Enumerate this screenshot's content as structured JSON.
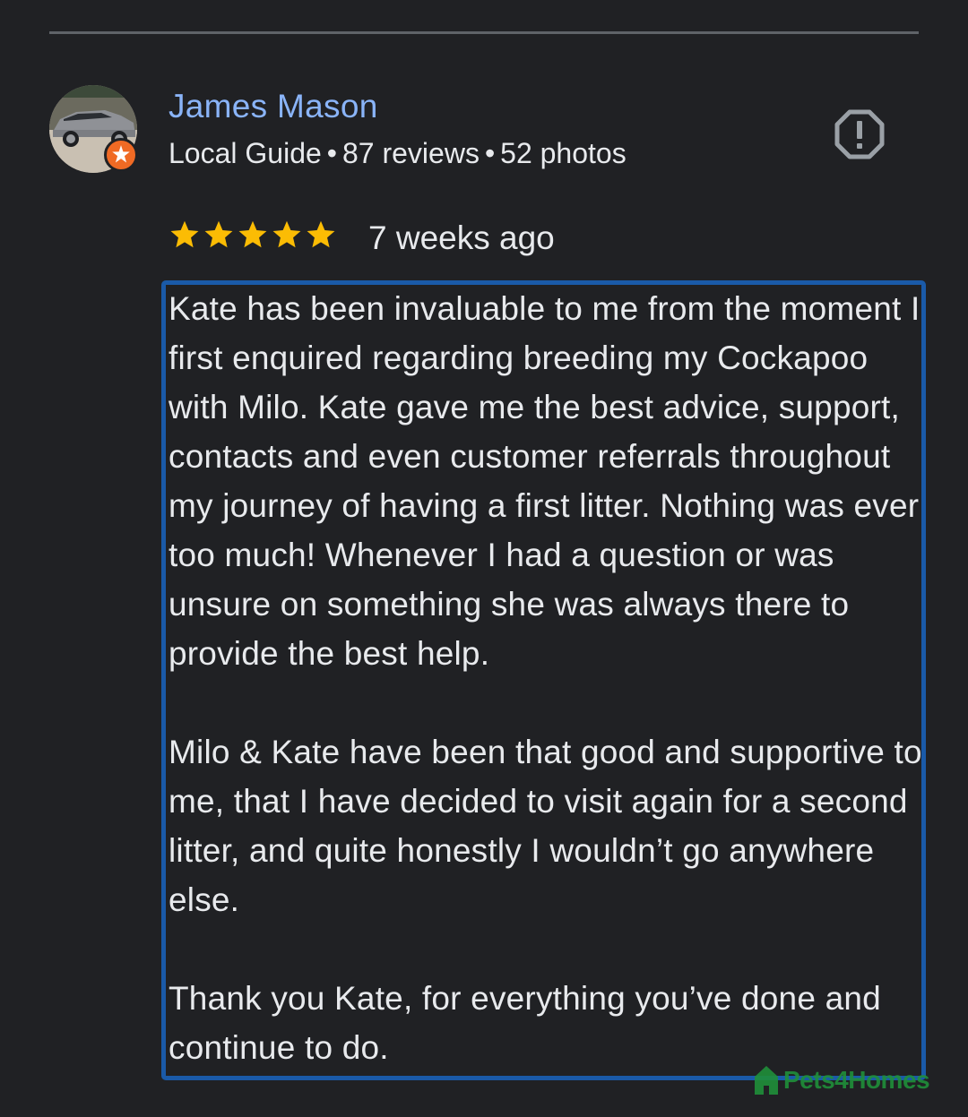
{
  "reviewer": {
    "name": "James Mason",
    "badge": "Local Guide",
    "reviews": "87 reviews",
    "photos": "52 photos",
    "separator": "•",
    "avatar_icon": "car-photo",
    "badge_icon": "local-guide-star-icon"
  },
  "rating": {
    "stars": 5,
    "max_stars": 5,
    "star_color": "#fbbc04",
    "time_ago": "7 weeks ago"
  },
  "report_icon": "report-icon",
  "review": {
    "paragraphs": [
      "Kate has been invaluable to me from the moment I first enquired regarding breeding my Cockapoo with Milo. Kate gave me the best advice, support, contacts and even customer referrals throughout my journey of having a first litter. Nothing was ever too much! Whenever I had a question or was unsure on something she was always there to provide the best help.",
      "Milo & Kate have been that good and supportive to me, that I have decided to visit again for a second litter, and quite honestly I wouldn’t go anywhere else.",
      "Thank you Kate, for everything you’ve done and continue to do."
    ],
    "highlight_color": "#1a5aa8"
  },
  "watermark": {
    "text": "Pets4Homes",
    "color": "#1f8f3a"
  },
  "colors": {
    "background": "#202124",
    "name": "#8ab4f8",
    "text": "#e8eaed",
    "divider": "#5f6368",
    "badge": "#f06a24"
  }
}
